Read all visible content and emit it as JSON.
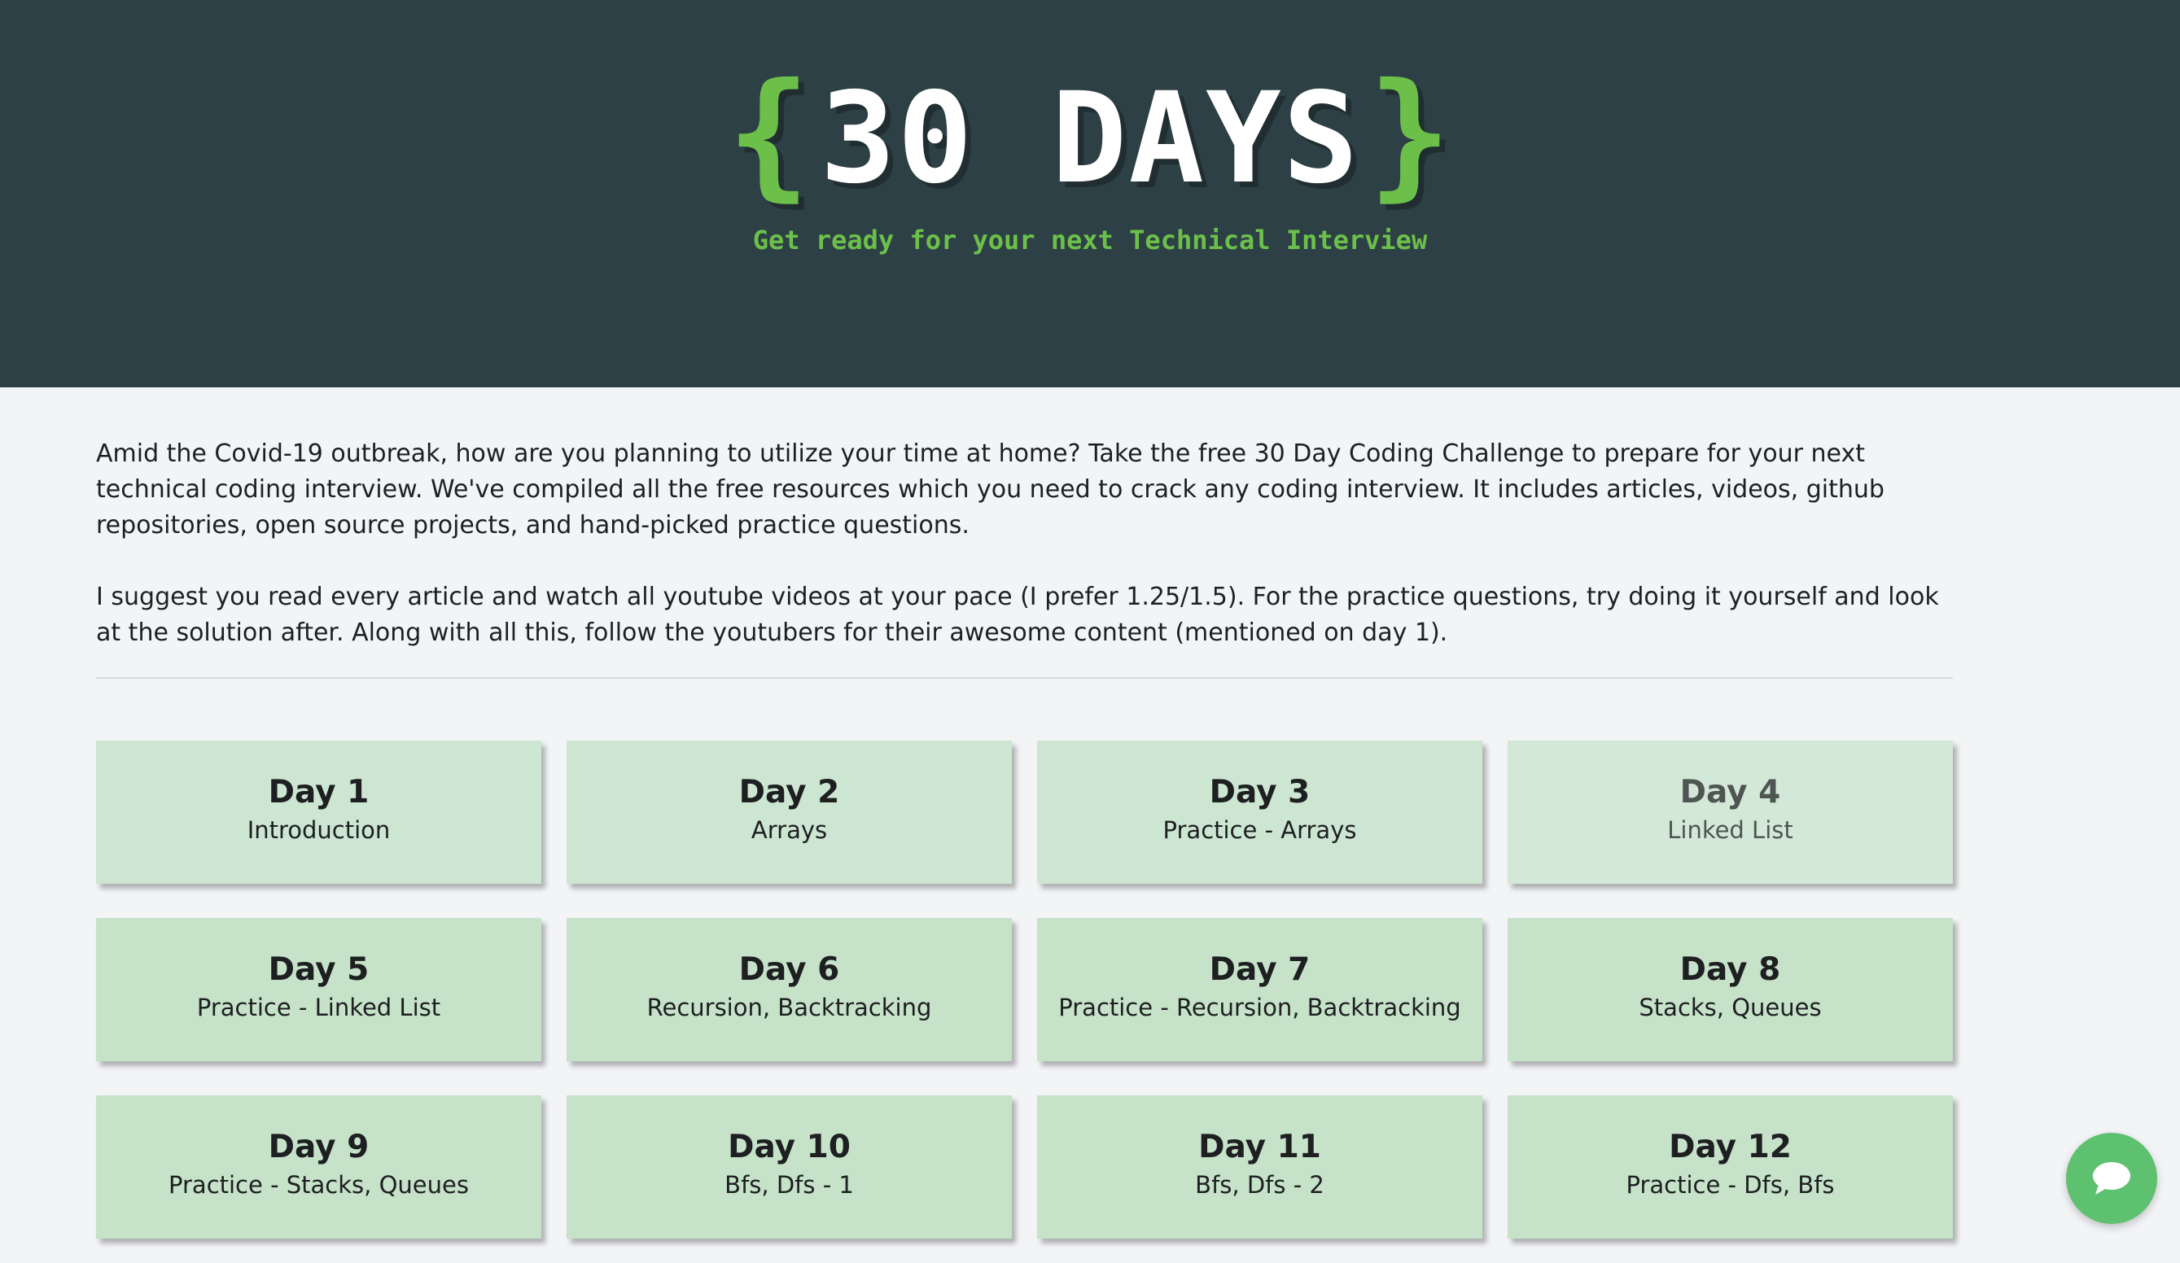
{
  "header": {
    "brace_open": "{",
    "title": "30 DAYS",
    "brace_close": "}",
    "tagline": "Get ready for your next Technical Interview"
  },
  "intro": {
    "paragraph_1": "Amid the Covid-19 outbreak, how are you planning to utilize your time at home? Take the free 30 Day Coding Challenge to prepare for your next technical coding interview. We've compiled all the free resources which you need to crack any coding interview. It includes articles, videos, github repositories, open source projects, and hand-picked practice questions.",
    "paragraph_2": "I suggest you read every article and watch all youtube videos at your pace (I prefer 1.25/1.5). For the practice questions, try doing it yourself and look at the solution after. Along with all this, follow the youtubers for their awesome content (mentioned on day 1)."
  },
  "days": [
    {
      "day": "Day 1",
      "topic": "Introduction"
    },
    {
      "day": "Day 2",
      "topic": "Arrays"
    },
    {
      "day": "Day 3",
      "topic": "Practice - Arrays"
    },
    {
      "day": "Day 4",
      "topic": "Linked List"
    },
    {
      "day": "Day 5",
      "topic": "Practice - Linked List"
    },
    {
      "day": "Day 6",
      "topic": "Recursion, Backtracking"
    },
    {
      "day": "Day 7",
      "topic": "Practice - Recursion, Backtracking"
    },
    {
      "day": "Day 8",
      "topic": "Stacks, Queues"
    },
    {
      "day": "Day 9",
      "topic": "Practice - Stacks, Queues"
    },
    {
      "day": "Day 10",
      "topic": "Bfs, Dfs - 1"
    },
    {
      "day": "Day 11",
      "topic": "Bfs, Dfs - 2"
    },
    {
      "day": "Day 12",
      "topic": "Practice - Dfs, Bfs"
    }
  ],
  "chat": {
    "icon": "chat-bubble-icon"
  },
  "colors": {
    "header_bg": "#2d4046",
    "accent_green": "#6cc04a",
    "card_bg": "#cde6d2",
    "chat_button": "#5ec16f"
  }
}
